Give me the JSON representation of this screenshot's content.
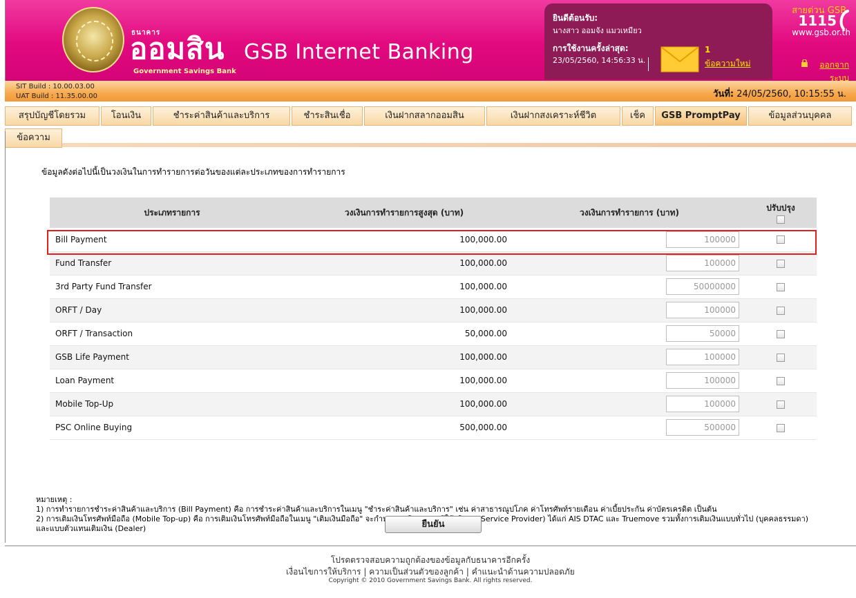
{
  "header": {
    "bank_small": "ธนาคาร",
    "bank_big": "ออมสิน",
    "bank_english": "Government Savings Bank",
    "app_title": "GSB Internet Banking",
    "welcome_title": "ยินดีต้อนรับ:",
    "welcome_name": "นางสาว ออมจัง แมวเหมียว",
    "last_login_label": "การใช้งานครั้งล่าสุด:",
    "last_login_value": "23/05/2560, 14:56:33 น.",
    "message_count": "1",
    "message_link": "ข้อความใหม่",
    "hotline_label": "สายด่วน GSB",
    "hotline_number": "1115",
    "website": "www.gsb.or.th",
    "logout": "ออกจากระบบ",
    "accent_color": "#e2097f",
    "welcome_bg": "#8e1b56"
  },
  "build": {
    "sit": "SIT Build : 10.00.03.00",
    "uat": "UAT Build : 11.35.00.00",
    "date_label": "วันที่:",
    "date_value": "24/05/2560, 10:15:55 น."
  },
  "tabs": [
    {
      "label": "สรุปบัญชีโดยรวม"
    },
    {
      "label": "โอนเงิน"
    },
    {
      "label": "ชำระค่าสินค้าและบริการ"
    },
    {
      "label": "ชำระสินเชื่อ"
    },
    {
      "label": "เงินฝากสลากออมสิน"
    },
    {
      "label": "เงินฝากสงเคราะห์ชีวิต"
    },
    {
      "label": "เช็ค"
    },
    {
      "label": "GSB PromptPay"
    },
    {
      "label": "ข้อมูลส่วนบุคคล"
    },
    {
      "label": "ข้อความ"
    }
  ],
  "main": {
    "intro": "ข้อมูลดังต่อไปนี้เป็นวงเงินในการทำรายการต่อวันของแต่ละประเภทของการทำรายการ",
    "columns": {
      "type": "ประเภทรายการ",
      "max": "วงเงินการทำรายการสูงสุด (บาท)",
      "current": "วงเงินการทำรายการ (บาท)",
      "update": "ปรับปรุง"
    },
    "rows": [
      {
        "type": "Bill Payment",
        "max": "100,000.00",
        "current": "100000"
      },
      {
        "type": "Fund Transfer",
        "max": "100,000.00",
        "current": "100000"
      },
      {
        "type": "3rd Party Fund Transfer",
        "max": "100,000.00",
        "current": "50000000"
      },
      {
        "type": "ORFT / Day",
        "max": "100,000.00",
        "current": "100000"
      },
      {
        "type": "ORFT / Transaction",
        "max": "50,000.00",
        "current": "50000"
      },
      {
        "type": "GSB Life Payment",
        "max": "100,000.00",
        "current": "100000"
      },
      {
        "type": "Loan Payment",
        "max": "100,000.00",
        "current": "100000"
      },
      {
        "type": "Mobile Top-Up",
        "max": "100,000.00",
        "current": "100000"
      },
      {
        "type": "PSC Online Buying",
        "max": "500,000.00",
        "current": "500000"
      }
    ],
    "notes_title": "หมายเหตุ :",
    "note1": "1) การทำรายการชำระค่าสินค้าและบริการ (Bill Payment) คือ การชำระค่าสินค้าและบริการในเมนู \"ชำระค่าสินค้าและบริการ\" เช่น ค่าสาธารณูปโภค ค่าโทรศัพท์รายเดือน ค่าเบี้ยประกัน ค่าบัตรเครดิต เป็นต้น",
    "note2": "2) การเติมเงินโทรศัพท์มือถือ (Mobile Top-up) คือ การเติมเงินโทรศัพท์มือถือในเมนู \"เติมเงินมือถือ\" จะกำหนดวงเงินรวมทุกผู้ให้บริการ (Service Provider) ได้แก่ AIS DTAC และ Truemove รวมทั้งการเติมเงินแบบทั่วไป (บุคคลธรรมดา) และแบบตัวแทนเติมเงิน (Dealer)",
    "confirm": "ยืนยัน"
  },
  "footer": {
    "verify": "โปรดตรวจสอบความถูกต้องของข้อมูลกับธนาคารอีกครั้ง",
    "link_terms": "เงื่อนไขการให้บริการ",
    "link_privacy": "ความเป็นส่วนตัวของลูกค้า",
    "link_security": "คำแนะนำด้านความปลอดภัย",
    "separator": "|",
    "copyright": "Copyright © 2010 Government Savings Bank. All rights reserved."
  }
}
